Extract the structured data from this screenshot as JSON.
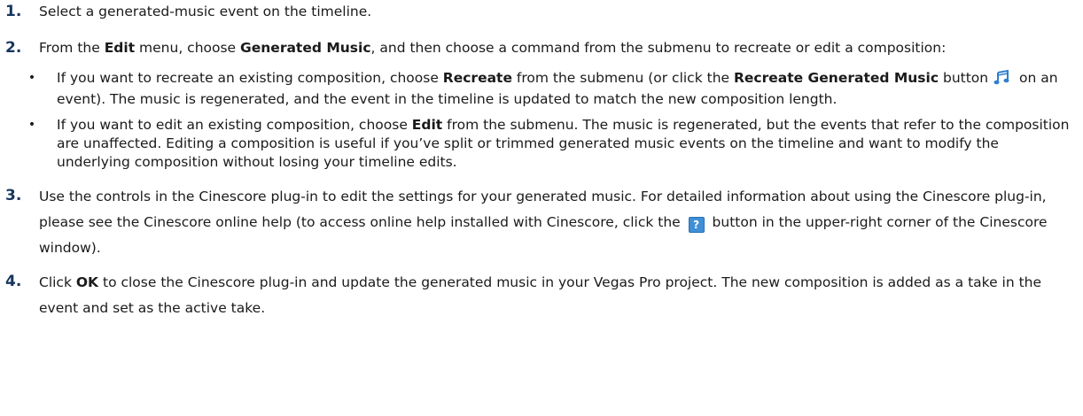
{
  "steps": [
    {
      "number": "1.",
      "text": "Select a generated-music event on the timeline."
    },
    {
      "number": "2.",
      "text_a": "From the ",
      "bold_edit": "Edit",
      "text_b": " menu, choose ",
      "bold_generated": "Generated Music",
      "text_c": ", and then choose a command from the submenu to recreate or edit a composition:",
      "bullets": [
        {
          "text_a": "If you want to recreate an existing composition, choose ",
          "bold_a": "Recreate",
          "text_b": " from the submenu (or click the ",
          "bold_b": "Recreate Generated Music",
          "text_c": " button",
          "icon": "music-note-icon",
          "text_d": " on an event). The music is regenerated, and the event in the timeline is updated to match the new composition length."
        },
        {
          "text_a": "If you want to edit an existing composition, choose ",
          "bold_a": "Edit",
          "text_b": " from the submenu. The music is regenerated, but the events that refer to the composition are unaffected. Editing a composition is useful if you’ve split or trimmed generated music events on the timeline and want to modify the underlying composition without losing your timeline edits."
        }
      ]
    },
    {
      "number": "3.",
      "text_a": "Use the controls in the Cinescore plug-in to edit the settings for your generated music. For detailed information about using the Cinescore plug-in, please see the Cinescore online help (to access online help installed with Cinescore, click the ",
      "icon_glyph": "?",
      "icon": "help-icon",
      "text_b": " button in the upper-right corner of the Cinescore window)."
    },
    {
      "number": "4.",
      "text_a": "Click ",
      "bold_ok": "OK",
      "text_b": " to close the Cinescore plug-in and update the generated music in your Vegas Pro project. The new composition is added as a take in the event and set as the active take."
    }
  ],
  "colors": {
    "step_number": "#17365d",
    "help_icon": "#3f8fd6",
    "music_icon": "#2e7fd0"
  }
}
